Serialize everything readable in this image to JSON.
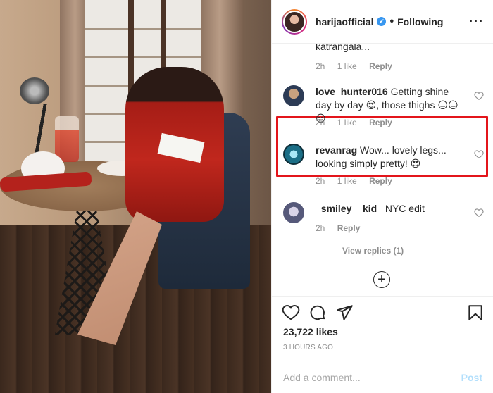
{
  "post": {
    "username": "harijaofficial",
    "verified_badge": "✔",
    "separator": "•",
    "follow_status": "Following",
    "more_label": "···"
  },
  "comments": {
    "cut_off_text": "katrangala...",
    "cut_off_meta": {
      "age": "2h",
      "likes": "1 like",
      "reply": "Reply"
    },
    "items": [
      {
        "username": "love_hunter016",
        "text": "Getting shine day by day 😍, those thighs 😑😑😑",
        "age": "2h",
        "likes": "1 like",
        "reply": "Reply",
        "highlighted": true
      },
      {
        "username": "revanrag",
        "text": "Wow... lovely legs... looking simply pretty! 😍",
        "age": "2h",
        "likes": "1 like",
        "reply": "Reply",
        "highlighted": false
      },
      {
        "username": "_smiley__kid_",
        "text": "NYC edit",
        "age": "2h",
        "likes": "",
        "reply": "Reply",
        "highlighted": false
      }
    ],
    "view_replies": "View replies (1)",
    "load_more_icon": "plus-circle-icon"
  },
  "actions": {
    "icons": [
      "heart-icon",
      "comment-icon",
      "share-icon",
      "bookmark-icon"
    ],
    "likes": "23,722 likes",
    "timestamp": "3 HOURS AGO"
  },
  "composer": {
    "placeholder": "Add a comment...",
    "post_label": "Post"
  },
  "colors": {
    "highlight_border": "#e3151b",
    "verified": "#3897f0",
    "post_disabled": "#b2dffc",
    "muted_text": "#8e8e8e"
  }
}
